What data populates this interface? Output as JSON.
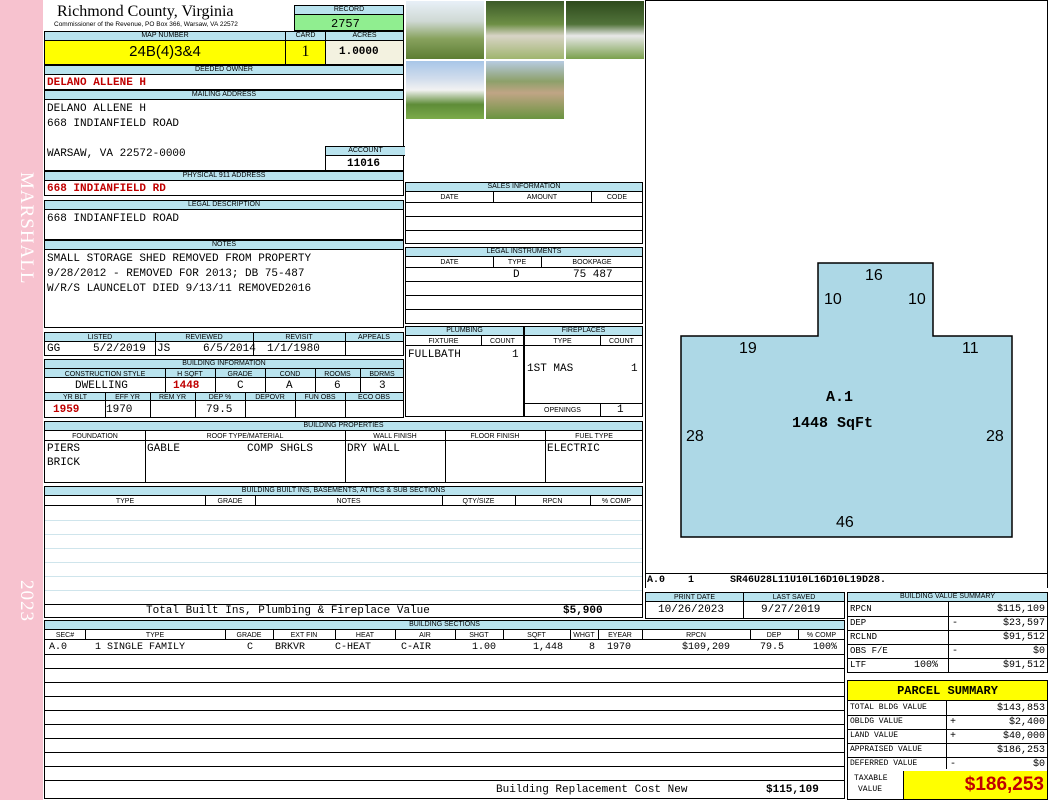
{
  "sidebar": {
    "district": "MARSHALL",
    "year": "2023"
  },
  "header": {
    "county": "Richmond County, Virginia",
    "commissioner": "Commissioner of the Revenue, PO Box 366, Warsaw, VA 22572"
  },
  "record": {
    "label": "RECORD",
    "value": "2757"
  },
  "map_number": {
    "label": "MAP NUMBER",
    "value": "24B(4)3&4"
  },
  "card": {
    "label": "CARD",
    "value": "1"
  },
  "acres": {
    "label": "ACRES",
    "value": "1.0000"
  },
  "deeded_owner": {
    "label": "DEEDED OWNER",
    "value": "DELANO ALLENE H"
  },
  "mailing": {
    "label": "MAILING ADDRESS",
    "line1": "DELANO ALLENE H",
    "line2": "668 INDIANFIELD ROAD",
    "line3": "WARSAW, VA 22572-0000"
  },
  "account": {
    "label": "ACCOUNT",
    "value": "11016"
  },
  "physical": {
    "label": "PHYSICAL 911 ADDRESS",
    "value": "668 INDIANFIELD RD"
  },
  "legal_desc": {
    "label": "LEGAL DESCRIPTION",
    "value": "668 INDIANFIELD ROAD"
  },
  "notes": {
    "label": "NOTES",
    "line1": "SMALL STORAGE SHED REMOVED FROM PROPERTY",
    "line2": "9/28/2012 - REMOVED FOR 2013; DB 75-487",
    "line3": "W/R/S LAUNCELOT DIED 9/13/11 REMOVED2016"
  },
  "listed": {
    "h_listed": "LISTED",
    "h_reviewed": "REVIEWED",
    "h_revisit": "REVISIT",
    "h_appeals": "APPEALS",
    "listed_by": "GG",
    "listed_date": "5/2/2019",
    "reviewed_by": "JS",
    "reviewed_date": "6/5/2014",
    "revisit": "1/1/1980"
  },
  "building_info": {
    "label": "BUILDING INFORMATION",
    "h_style": "CONSTRUCTION STYLE",
    "h_hsqft": "H SQFT",
    "h_grade": "GRADE",
    "h_cond": "COND",
    "h_rooms": "ROOMS",
    "h_bdrms": "BDRMS",
    "style": "DWELLING",
    "hsqft": "1448",
    "grade": "C",
    "cond": "A",
    "rooms": "6",
    "bdrms": "3",
    "h_yrblt": "YR BLT",
    "h_effyr": "EFF YR",
    "h_remyr": "REM YR",
    "h_dep": "DEP %",
    "h_depovr": "DEPOVR",
    "h_funobs": "FUN OBS",
    "h_ecoobs": "ECO OBS",
    "yrblt": "1959",
    "effyr": "1970",
    "dep": "79.5"
  },
  "sales": {
    "label": "SALES INFORMATION",
    "h_date": "DATE",
    "h_amount": "AMOUNT",
    "h_code": "CODE"
  },
  "legal_instruments": {
    "label": "LEGAL INSTRUMENTS",
    "h_date": "DATE",
    "h_type": "TYPE",
    "h_book": "BOOKPAGE",
    "type": "D",
    "bookpage": "75 487"
  },
  "plumbing": {
    "label": "PLUMBING",
    "h_fixture": "FIXTURE",
    "h_count": "COUNT",
    "fixture": "FULLBATH",
    "count": "1"
  },
  "fireplaces": {
    "label": "FIREPLACES",
    "h_type": "TYPE",
    "h_count": "COUNT",
    "type": "1ST MAS",
    "count": "1",
    "openings_label": "OPENINGS",
    "openings": "1"
  },
  "properties": {
    "label": "BUILDING PROPERTIES",
    "h_foundation": "FOUNDATION",
    "h_roof": "ROOF TYPE/MATERIAL",
    "h_wall": "WALL FINISH",
    "h_floor": "FLOOR FINISH",
    "h_fuel": "FUEL TYPE",
    "foundation1": "PIERS",
    "foundation2": "BRICK",
    "roof_type": "GABLE",
    "roof_mat": "COMP SHGLS",
    "wall": "DRY WALL",
    "fuel": "ELECTRIC"
  },
  "builtins": {
    "label": "BUILDING BUILT INS, BASEMENTS, ATTICS & SUB SECTIONS",
    "h_type": "TYPE",
    "h_grade": "GRADE",
    "h_notes": "NOTES",
    "h_qty": "QTY/SIZE",
    "h_rpcn": "RPCN",
    "h_comp": "% COMP",
    "total_label": "Total Built Ins, Plumbing & Fireplace Value",
    "total_value": "$5,900"
  },
  "sketch": {
    "area_label": "A.1",
    "sqft": "1448 SqFt",
    "d_top": "16",
    "d_notch_l": "10",
    "d_notch_r": "10",
    "d_left_top": "19",
    "d_right_top": "11",
    "d_left": "28",
    "d_right": "28",
    "d_bottom": "46",
    "code_sec": "A.0",
    "code_num": "1",
    "code_path": "SR46U28L11U10L16D10L19D28."
  },
  "dates": {
    "h_print": "PRINT DATE",
    "h_saved": "LAST SAVED",
    "print": "10/26/2023",
    "saved": "9/27/2019"
  },
  "sections": {
    "label": "BUILDING SECTIONS",
    "h_sec": "SEC#",
    "h_type": "TYPE",
    "h_grade": "GRADE",
    "h_extfin": "EXT FIN",
    "h_heat": "HEAT",
    "h_air": "AIR",
    "h_shgt": "SHGT",
    "h_sqft": "SQFT",
    "h_whgt": "WHGT",
    "h_eyear": "EYEAR",
    "h_rpcn": "RPCN",
    "h_dep": "DEP",
    "h_comp": "% COMP",
    "sec": "A.0",
    "type": "1 SINGLE FAMILY",
    "grade": "C",
    "extfin": "BRKVR",
    "heat": "C-HEAT",
    "air": "C-AIR",
    "shgt": "1.00",
    "sqft": "1,448",
    "whgt": "8",
    "eyear": "1970",
    "rpcn": "$109,209",
    "dep": "79.5",
    "comp": "100%",
    "replacement_label": "Building Replacement Cost New",
    "replacement_value": "$115,109"
  },
  "value_summary": {
    "label": "BUILDING VALUE SUMMARY",
    "rpcn_l": "RPCN",
    "rpcn": "$115,109",
    "dep_l": "DEP",
    "dep_sign": "-",
    "dep": "$23,597",
    "rclnd_l": "RCLND",
    "rclnd": "$91,512",
    "obs_l": "OBS F/E",
    "obs_sign": "-",
    "obs": "$0",
    "ltf_l": "LTF",
    "ltf_pct": "100%",
    "ltf": "$91,512"
  },
  "parcel": {
    "label": "PARCEL SUMMARY",
    "tbv_l": "TOTAL BLDG VALUE",
    "tbv": "$143,853",
    "obldg_l": "OBLDG VALUE",
    "obldg_sign": "+",
    "obldg": "$2,400",
    "land_l": "LAND VALUE",
    "land_sign": "+",
    "land": "$40,000",
    "appr_l": "APPRAISED VALUE",
    "appr": "$186,253",
    "def_l": "DEFERRED VALUE",
    "def_sign": "-",
    "def": "$0",
    "taxable_l1": "TAXABLE",
    "taxable_l2": "VALUE",
    "taxable": "$186,253"
  },
  "colors": {
    "sidebar": "#f7c2cf",
    "header": "#b9e3ee",
    "highlight": "#ffff00",
    "record": "#90ee90",
    "sketch_fill": "#add8e6",
    "red": "#c00000"
  }
}
